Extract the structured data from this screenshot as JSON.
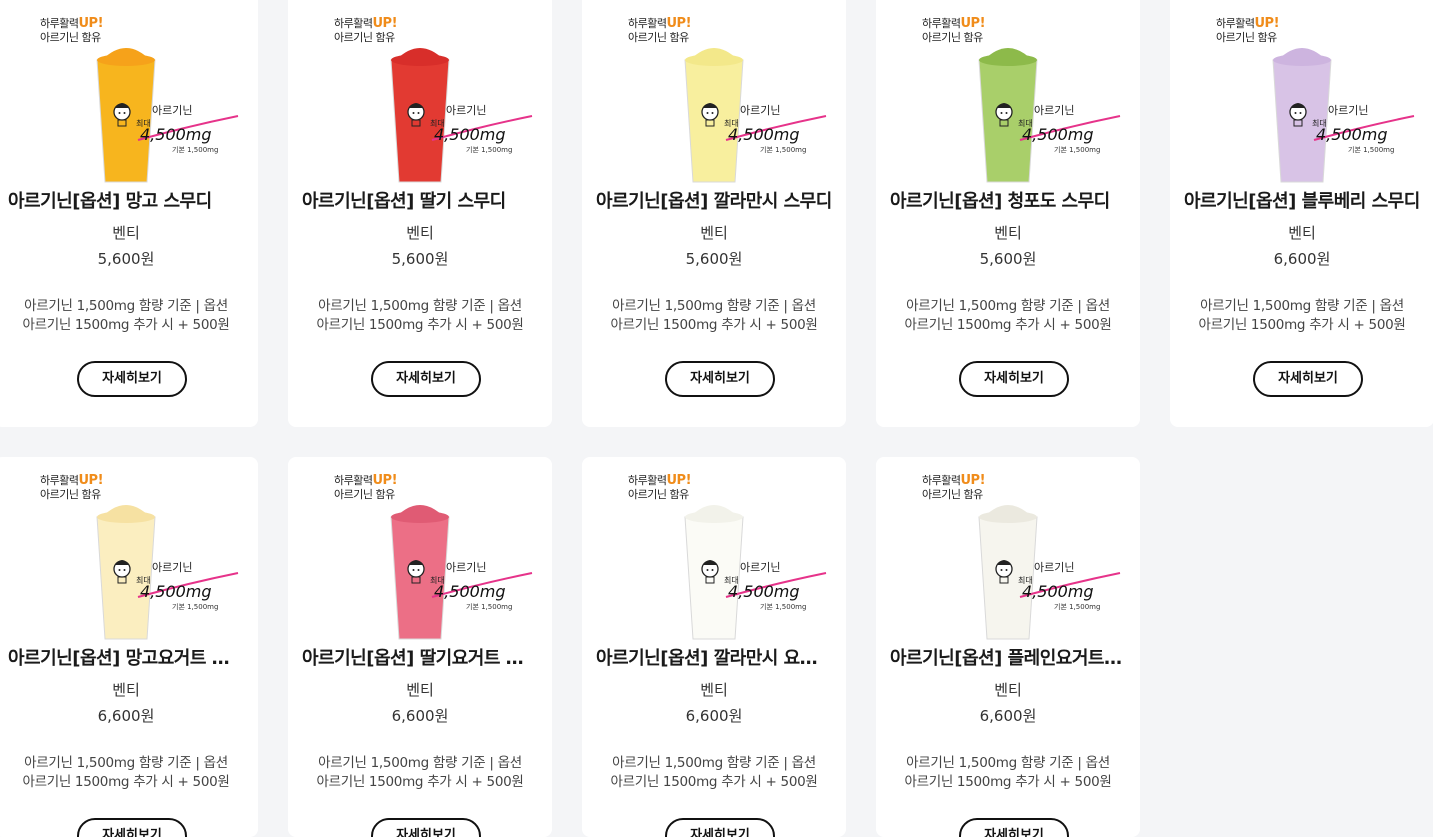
{
  "promo": {
    "line1": "하루활력",
    "up": "UP!",
    "line2": "아르기닌 함유"
  },
  "stamp": {
    "brand": "아르기닌",
    "max": "최대",
    "amount": "4,500mg",
    "base": "기본 1,500mg"
  },
  "products": [
    {
      "title": "아르기닌[옵션] 망고 스무디",
      "size": "벤티",
      "price": "5,600원",
      "desc1": "아르기닌 1,500mg 함량 기준 | 옵션",
      "desc2": "아르기닌 1500mg 추가 시 + 500원",
      "button": "자세히보기",
      "color": "#f7b51e",
      "top_color": "#f6a21a"
    },
    {
      "title": "아르기닌[옵션] 딸기 스무디",
      "size": "벤티",
      "price": "5,600원",
      "desc1": "아르기닌 1,500mg 함량 기준 | 옵션",
      "desc2": "아르기닌 1500mg 추가 시 + 500원",
      "button": "자세히보기",
      "color": "#e23a32",
      "top_color": "#d82e2a"
    },
    {
      "title": "아르기닌[옵션] 깔라만시 스무디",
      "size": "벤티",
      "price": "5,600원",
      "desc1": "아르기닌 1,500mg 함량 기준 | 옵션",
      "desc2": "아르기닌 1500mg 추가 시 + 500원",
      "button": "자세히보기",
      "color": "#f8ef9e",
      "top_color": "#f3e88a"
    },
    {
      "title": "아르기닌[옵션] 청포도 스무디",
      "size": "벤티",
      "price": "5,600원",
      "desc1": "아르기닌 1,500mg 함량 기준 | 옵션",
      "desc2": "아르기닌 1500mg 추가 시 + 500원",
      "button": "자세히보기",
      "color": "#a9cf6a",
      "top_color": "#8dba4a"
    },
    {
      "title": "아르기닌[옵션] 블루베리 스무디",
      "size": "벤티",
      "price": "6,600원",
      "desc1": "아르기닌 1,500mg 함량 기준 | 옵션",
      "desc2": "아르기닌 1500mg 추가 시 + 500원",
      "button": "자세히보기",
      "color": "#d8c3e6",
      "top_color": "#cdb4df"
    },
    {
      "title": "아르기닌[옵션] 망고요거트 스무디",
      "size": "벤티",
      "price": "6,600원",
      "desc1": "아르기닌 1,500mg 함량 기준 | 옵션",
      "desc2": "아르기닌 1500mg 추가 시 + 500원",
      "button": "자세히보기",
      "color": "#fbeec0",
      "top_color": "#f6e1a2"
    },
    {
      "title": "아르기닌[옵션] 딸기요거트 스무디",
      "size": "벤티",
      "price": "6,600원",
      "desc1": "아르기닌 1,500mg 함량 기준 | 옵션",
      "desc2": "아르기닌 1500mg 추가 시 + 500원",
      "button": "자세히보기",
      "color": "#ec6f86",
      "top_color": "#e05b74"
    },
    {
      "title": "아르기닌[옵션] 깔라만시 요거트 스무디",
      "size": "벤티",
      "price": "6,600원",
      "desc1": "아르기닌 1,500mg 함량 기준 | 옵션",
      "desc2": "아르기닌 1500mg 추가 시 + 500원",
      "button": "자세히보기",
      "color": "#fbfbf6",
      "top_color": "#f2f2ea"
    },
    {
      "title": "아르기닌[옵션] 플레인요거트 스무디",
      "size": "벤티",
      "price": "6,600원",
      "desc1": "아르기닌 1,500mg 함량 기준 | 옵션",
      "desc2": "아르기닌 1500mg 추가 시 + 500원",
      "button": "자세히보기",
      "color": "#f6f5ee",
      "top_color": "#ebe9df"
    }
  ]
}
